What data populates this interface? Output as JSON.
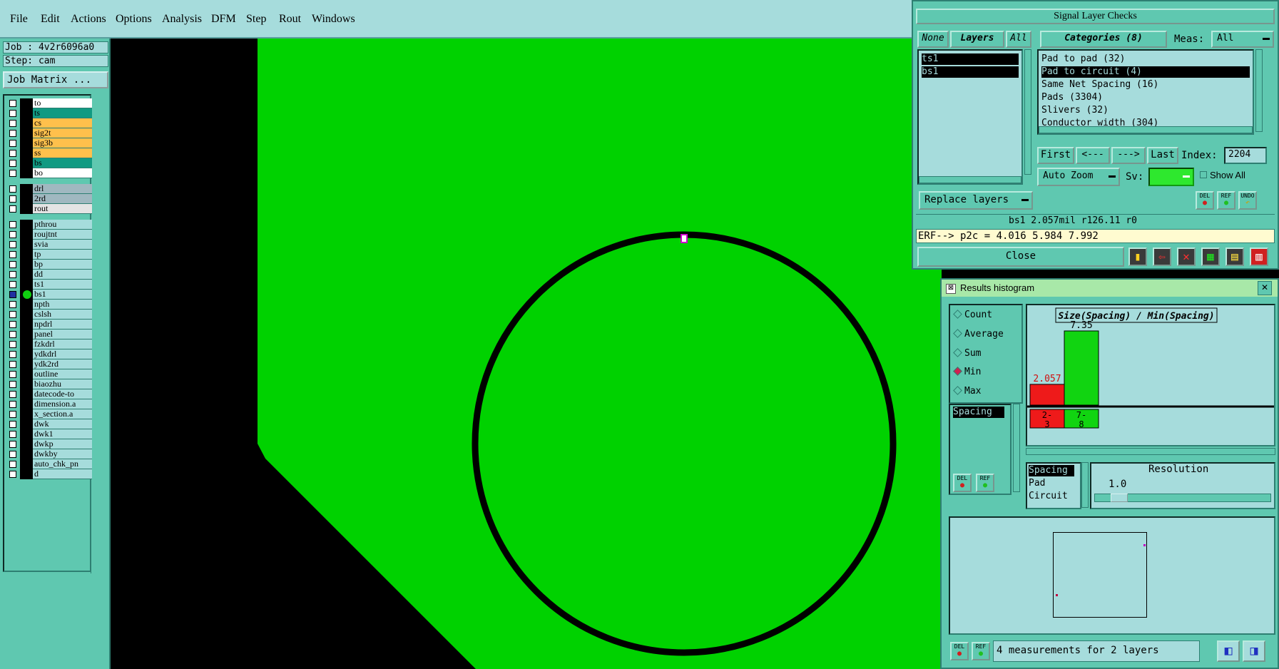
{
  "menu": [
    "File",
    "Edit",
    "Actions",
    "Options",
    "Analysis",
    "DFM",
    "Step",
    "Rout",
    "Windows"
  ],
  "job": {
    "job_line": "Job : 4v2r6096a0",
    "step_line": "Step: cam",
    "matrix_button": "Job Matrix ..."
  },
  "layers": [
    {
      "name": "to",
      "color": "#ffffff"
    },
    {
      "name": "ts",
      "color": "#119a82"
    },
    {
      "name": "cs",
      "color": "#ffc04c"
    },
    {
      "name": "sig2t",
      "color": "#ffc04c"
    },
    {
      "name": "sig3b",
      "color": "#ffc04c"
    },
    {
      "name": "ss",
      "color": "#ffc04c"
    },
    {
      "name": "bs",
      "color": "#119a82"
    },
    {
      "name": "bo",
      "color": "#ffffff"
    },
    {
      "name": "drl",
      "color": "#a0b8c0"
    },
    {
      "name": "2rd",
      "color": "#a0b8c0"
    },
    {
      "name": "rout",
      "color": "#e4e4e4"
    },
    {
      "name": "pthrou",
      "color": "#a6dcdc"
    },
    {
      "name": "roujtnt",
      "color": "#a6dcdc"
    },
    {
      "name": "svia",
      "color": "#a6dcdc"
    },
    {
      "name": "tp",
      "color": "#a6dcdc"
    },
    {
      "name": "bp",
      "color": "#a6dcdc"
    },
    {
      "name": "dd",
      "color": "#a6dcdc"
    },
    {
      "name": "ts1",
      "color": "#a6dcdc"
    },
    {
      "name": "bs1",
      "color": "#a6dcdc"
    },
    {
      "name": "npth",
      "color": "#a6dcdc"
    },
    {
      "name": "cslsh",
      "color": "#a6dcdc"
    },
    {
      "name": "npdrl",
      "color": "#a6dcdc"
    },
    {
      "name": "panel",
      "color": "#a6dcdc"
    },
    {
      "name": "fzkdrl",
      "color": "#a6dcdc"
    },
    {
      "name": "ydkdrl",
      "color": "#a6dcdc"
    },
    {
      "name": "ydk2rd",
      "color": "#a6dcdc"
    },
    {
      "name": "outline",
      "color": "#a6dcdc"
    },
    {
      "name": "biaozhu",
      "color": "#a6dcdc"
    },
    {
      "name": "datecode-to",
      "color": "#a6dcdc"
    },
    {
      "name": "dimension.a",
      "color": "#a6dcdc"
    },
    {
      "name": "x_section.a",
      "color": "#a6dcdc"
    },
    {
      "name": "dwk",
      "color": "#a6dcdc"
    },
    {
      "name": "dwk1",
      "color": "#a6dcdc"
    },
    {
      "name": "dwkp",
      "color": "#a6dcdc"
    },
    {
      "name": "dwkby",
      "color": "#a6dcdc"
    },
    {
      "name": "auto_chk_pn",
      "color": "#a6dcdc"
    },
    {
      "name": "d",
      "color": "#a6dcdc"
    }
  ],
  "slc": {
    "title": "Signal Layer Checks",
    "none_btn": "None",
    "layers_btn": "Layers",
    "all_btn": "All",
    "categories_btn": "Categories (8)",
    "meas_label": "Meas:",
    "meas_value": "All",
    "layer_items": [
      "ts1",
      "bs1"
    ],
    "categories": [
      "Pad to pad (32)",
      "Pad to circuit (4)",
      "Same Net Spacing (16)",
      "Pads (3304)",
      "Slivers (32)",
      "Conductor width (304)"
    ],
    "first_btn": "First",
    "prev_btn": "<---",
    "next_btn": "--->",
    "last_btn": "Last",
    "index_label": "Index:",
    "index_value": "2204",
    "autozoom_btn": "Auto Zoom",
    "sv_label": "Sv:",
    "showall_label": "Show All",
    "replace_btn": "Replace layers",
    "del_label": "DEL",
    "ref_label": "REF",
    "undo_label": "UNDO",
    "status": "bs1 2.057mil  r126.11  r0",
    "erf": "ERF--> p2c = 4.016 5.984 7.992",
    "close_btn": "Close"
  },
  "hist": {
    "title": "Results histogram",
    "modes": [
      "Count",
      "Average",
      "Sum",
      "Min",
      "Max"
    ],
    "selected_mode": "Min",
    "type_item": "Spacing",
    "chart_title": "Size(Spacing) / Min(Spacing)",
    "resolution_label": "Resolution",
    "resolution_value": "1.0",
    "measure_list": [
      "Spacing",
      "Pad",
      "Circuit"
    ],
    "footer": "4 measurements for 2 layers",
    "del_label": "DEL",
    "ref_label": "REF"
  },
  "chart_data": {
    "type": "bar",
    "title": "Size(Spacing) / Min(Spacing)",
    "categories": [
      "2-3",
      "7-8"
    ],
    "values": [
      2.057,
      7.35
    ],
    "colors": [
      "#ee1a1a",
      "#11d411"
    ]
  }
}
